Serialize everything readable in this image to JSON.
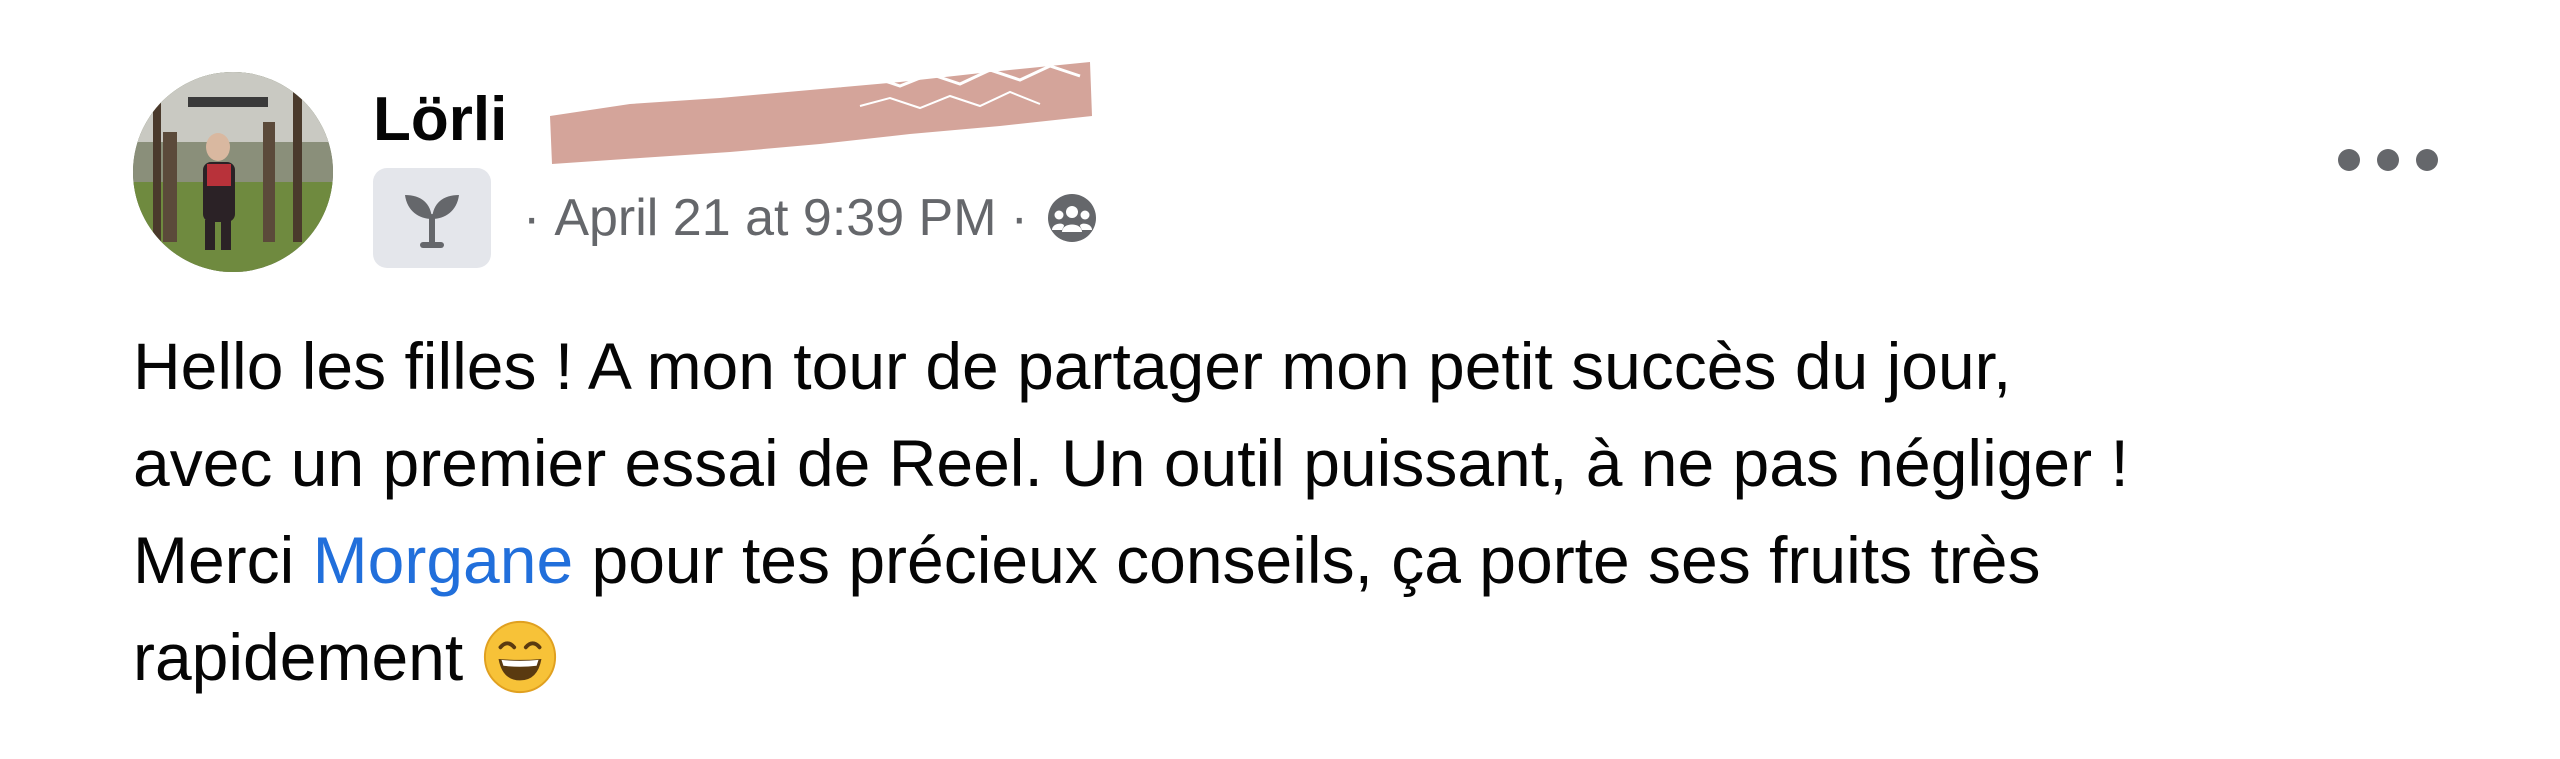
{
  "post": {
    "author_first_name": "Lörli",
    "badge_icon": "sprout-icon",
    "separator": "·",
    "timestamp": "April 21 at 9:39 PM",
    "audience_icon": "group-audience-icon",
    "more_icon": "more-options-icon",
    "message": {
      "line1": "Hello les filles ! A mon tour de partager mon petit succès du jour,",
      "line2": "avec un premier essai de Reel. Un outil puissant, à ne pas négliger !",
      "line3_before": "Merci ",
      "mention": "Morgane",
      "line3_after": " pour tes précieux conseils, ça porte ses fruits très",
      "line4": "rapidement",
      "emoji": "grinning-face-emoji"
    }
  },
  "colors": {
    "text": "#050505",
    "secondary_text": "#65676b",
    "mention": "#216fdb",
    "badge_background": "#e4e6eb",
    "redaction": "#d4a49a"
  }
}
